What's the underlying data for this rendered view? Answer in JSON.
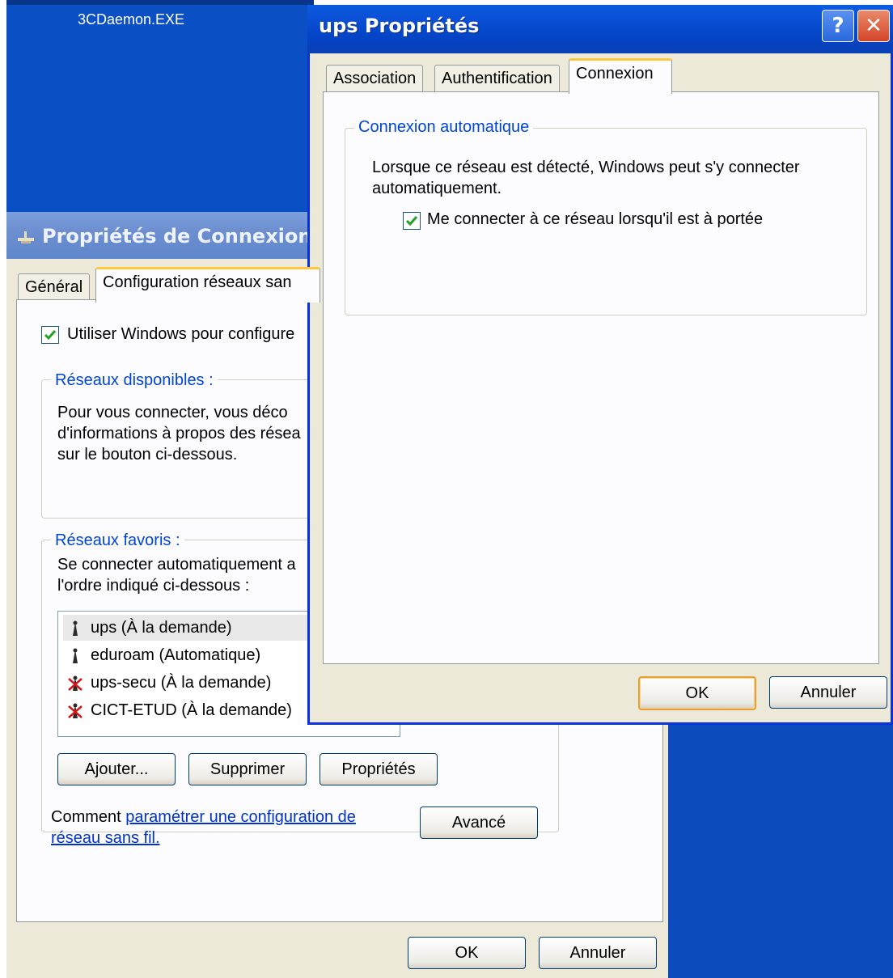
{
  "desktop": {
    "file_label": "3CDaemon.EXE"
  },
  "back_window": {
    "title": "Propriétés de Connexion re",
    "tabs": [
      "Général",
      "Configuration réseaux san"
    ],
    "use_windows_checkbox_label": "Utiliser Windows pour configure",
    "available_networks": {
      "title": "Réseaux disponibles :",
      "text_lines": [
        "Pour vous connecter, vous déco",
        "d'informations à propos des résea",
        "sur le bouton ci-dessous."
      ]
    },
    "preferred_networks": {
      "title": "Réseaux favoris :",
      "text_lines": [
        "Se connecter automatiquement a",
        "l'ordre indiqué ci-dessous :"
      ],
      "items": [
        {
          "label": "ups (À la demande)",
          "icon": "network-antenna-icon"
        },
        {
          "label": "eduroam (Automatique)",
          "icon": "network-antenna-icon"
        },
        {
          "label": "ups-secu (À la demande)",
          "icon": "network-antenna-disabled-icon"
        },
        {
          "label": "CICT-ETUD (À la demande)",
          "icon": "network-antenna-disabled-icon"
        }
      ]
    },
    "buttons": {
      "add": "Ajouter...",
      "remove": "Supprimer",
      "properties": "Propriétés",
      "advanced": "Avancé",
      "ok": "OK",
      "cancel": "Annuler"
    },
    "help_text_prefix": "Comment ",
    "help_link_line1": "paramétrer une configuration de",
    "help_link_line2": "réseau sans fil."
  },
  "front_window": {
    "title": "ups Propriétés",
    "help_button": "?",
    "close_button": "✕",
    "tabs": [
      "Association",
      "Authentification",
      "Connexion"
    ],
    "active_tab_index": 2,
    "group_title": "Connexion automatique",
    "description_lines": [
      "Lorsque ce réseau est détecté, Windows peut s'y connecter",
      "automatiquement."
    ],
    "auto_connect_checkbox_label": "Me connecter à ce réseau lorsqu'il est à portée",
    "auto_connect_checked": true,
    "buttons": {
      "ok": "OK",
      "cancel": "Annuler"
    }
  },
  "colors": {
    "xp_blue": "#0a4fd6",
    "group_title_blue": "#0046d5",
    "face": "#ece9d8",
    "check_green": "#21a121"
  }
}
